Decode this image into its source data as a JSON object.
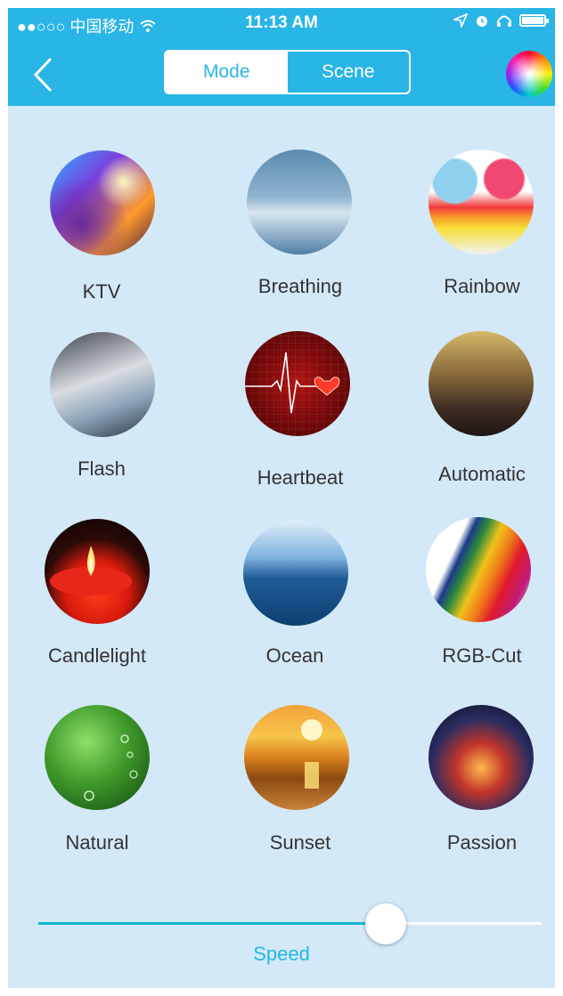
{
  "status_bar": {
    "carrier": "●●○○○ 中国移动",
    "time": "11:13 AM"
  },
  "nav": {
    "tabs": [
      {
        "label": "Mode",
        "selected": true
      },
      {
        "label": "Scene",
        "selected": false
      }
    ],
    "accent_color": "#29b5e6"
  },
  "modes": [
    {
      "label": "KTV",
      "icon": "ktv-photo-icon"
    },
    {
      "label": "Breathing",
      "icon": "breathing-photo-icon"
    },
    {
      "label": "Rainbow",
      "icon": "rainbow-photo-icon"
    },
    {
      "label": "Flash",
      "icon": "flash-photo-icon"
    },
    {
      "label": "Heartbeat",
      "icon": "heartbeat-photo-icon"
    },
    {
      "label": "Automatic",
      "icon": "automatic-photo-icon"
    },
    {
      "label": "Candlelight",
      "icon": "candlelight-photo-icon"
    },
    {
      "label": "Ocean",
      "icon": "ocean-photo-icon"
    },
    {
      "label": "RGB-Cut",
      "icon": "rgb-cut-photo-icon"
    },
    {
      "label": "Natural",
      "icon": "natural-photo-icon"
    },
    {
      "label": "Sunset",
      "icon": "sunset-photo-icon"
    },
    {
      "label": "Passion",
      "icon": "passion-photo-icon"
    }
  ],
  "speed": {
    "label": "Speed",
    "value_fraction": 0.69
  },
  "colors": {
    "background": "#d3e9f8",
    "slider_fill": "#12b5d6",
    "speed_label": "#22b6e4"
  }
}
